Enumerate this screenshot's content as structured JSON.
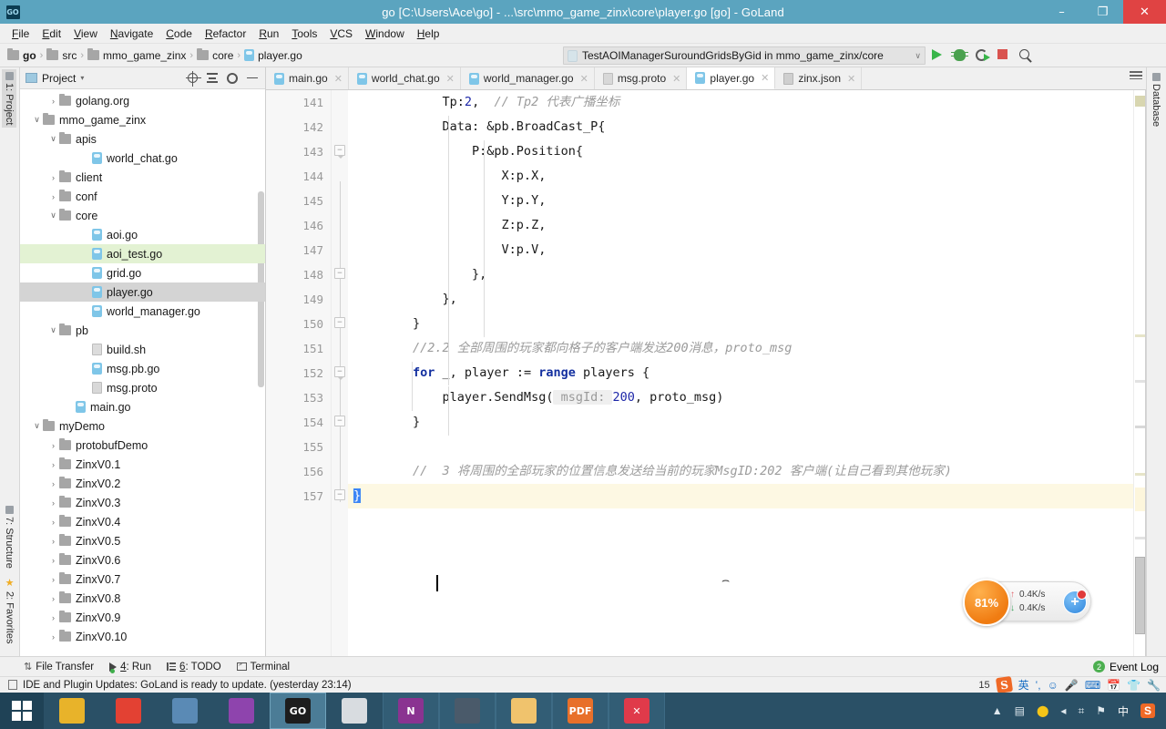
{
  "window": {
    "title": "go [C:\\Users\\Ace\\go] - ...\\src\\mmo_game_zinx\\core\\player.go [go] - GoLand",
    "app_icon": "GO",
    "minimize": "–",
    "maximize": "❐",
    "close": "✕"
  },
  "menubar": {
    "items": [
      "File",
      "Edit",
      "View",
      "Navigate",
      "Code",
      "Refactor",
      "Run",
      "Tools",
      "VCS",
      "Window",
      "Help"
    ]
  },
  "breadcrumb": {
    "items": [
      {
        "label": "go",
        "icon": "folder-icon",
        "bold": true
      },
      {
        "label": "src",
        "icon": "folder-icon",
        "bold": false
      },
      {
        "label": "mmo_game_zinx",
        "icon": "folder-icon",
        "bold": false
      },
      {
        "label": "core",
        "icon": "folder-icon",
        "bold": false
      },
      {
        "label": "player.go",
        "icon": "go-file-icon",
        "bold": false
      }
    ],
    "separator": "›"
  },
  "run_config": {
    "label": "TestAOIManagerSuroundGridsByGid in mmo_game_zinx/core",
    "dropdown_arrow": "∨",
    "buttons": [
      "run-icon",
      "debug-icon",
      "run-coverage-icon",
      "stop-icon",
      "search-everywhere-icon"
    ]
  },
  "project_panel": {
    "title": "Project",
    "caret": "▾",
    "toolbar_icons": [
      "locate-icon",
      "collapse-all-icon",
      "settings-gear-icon",
      "hide-panel-icon"
    ],
    "tree": [
      {
        "depth": 2,
        "arrow": "›",
        "icon": "folder-icon",
        "label": "golang.org",
        "state": "collapsed"
      },
      {
        "depth": 1,
        "arrow": "∨",
        "icon": "folder-icon",
        "label": "mmo_game_zinx",
        "state": "expanded"
      },
      {
        "depth": 2,
        "arrow": "∨",
        "icon": "folder-icon",
        "label": "apis",
        "state": "expanded"
      },
      {
        "depth": 4,
        "arrow": "",
        "icon": "go-file-icon",
        "label": "world_chat.go",
        "state": "file"
      },
      {
        "depth": 2,
        "arrow": "›",
        "icon": "folder-icon",
        "label": "client",
        "state": "collapsed"
      },
      {
        "depth": 2,
        "arrow": "›",
        "icon": "folder-icon",
        "label": "conf",
        "state": "collapsed"
      },
      {
        "depth": 2,
        "arrow": "∨",
        "icon": "folder-icon",
        "label": "core",
        "state": "expanded"
      },
      {
        "depth": 4,
        "arrow": "",
        "icon": "go-file-icon",
        "label": "aoi.go",
        "state": "file"
      },
      {
        "depth": 4,
        "arrow": "",
        "icon": "go-test-file-icon",
        "label": "aoi_test.go",
        "state": "file",
        "highlight": "green"
      },
      {
        "depth": 4,
        "arrow": "",
        "icon": "go-file-icon",
        "label": "grid.go",
        "state": "file"
      },
      {
        "depth": 4,
        "arrow": "",
        "icon": "go-file-icon",
        "label": "player.go",
        "state": "file",
        "highlight": "selected"
      },
      {
        "depth": 4,
        "arrow": "",
        "icon": "go-file-icon",
        "label": "world_manager.go",
        "state": "file"
      },
      {
        "depth": 2,
        "arrow": "∨",
        "icon": "folder-icon",
        "label": "pb",
        "state": "expanded"
      },
      {
        "depth": 4,
        "arrow": "",
        "icon": "sh-file-icon",
        "label": "build.sh",
        "state": "file"
      },
      {
        "depth": 4,
        "arrow": "",
        "icon": "go-file-icon",
        "label": "msg.pb.go",
        "state": "file"
      },
      {
        "depth": 4,
        "arrow": "",
        "icon": "proto-file-icon",
        "label": "msg.proto",
        "state": "file"
      },
      {
        "depth": 3,
        "arrow": "",
        "icon": "go-file-icon",
        "label": "main.go",
        "state": "file"
      },
      {
        "depth": 1,
        "arrow": "∨",
        "icon": "folder-icon",
        "label": "myDemo",
        "state": "expanded"
      },
      {
        "depth": 2,
        "arrow": "›",
        "icon": "folder-icon",
        "label": "protobufDemo",
        "state": "collapsed"
      },
      {
        "depth": 2,
        "arrow": "›",
        "icon": "folder-icon",
        "label": "ZinxV0.1",
        "state": "collapsed"
      },
      {
        "depth": 2,
        "arrow": "›",
        "icon": "folder-icon",
        "label": "ZinxV0.2",
        "state": "collapsed"
      },
      {
        "depth": 2,
        "arrow": "›",
        "icon": "folder-icon",
        "label": "ZinxV0.3",
        "state": "collapsed"
      },
      {
        "depth": 2,
        "arrow": "›",
        "icon": "folder-icon",
        "label": "ZinxV0.4",
        "state": "collapsed"
      },
      {
        "depth": 2,
        "arrow": "›",
        "icon": "folder-icon",
        "label": "ZinxV0.5",
        "state": "collapsed"
      },
      {
        "depth": 2,
        "arrow": "›",
        "icon": "folder-icon",
        "label": "ZinxV0.6",
        "state": "collapsed"
      },
      {
        "depth": 2,
        "arrow": "›",
        "icon": "folder-icon",
        "label": "ZinxV0.7",
        "state": "collapsed"
      },
      {
        "depth": 2,
        "arrow": "›",
        "icon": "folder-icon",
        "label": "ZinxV0.8",
        "state": "collapsed"
      },
      {
        "depth": 2,
        "arrow": "›",
        "icon": "folder-icon",
        "label": "ZinxV0.9",
        "state": "collapsed"
      },
      {
        "depth": 2,
        "arrow": "›",
        "icon": "folder-icon",
        "label": "ZinxV0.10",
        "state": "collapsed"
      }
    ]
  },
  "left_tool_strips": {
    "project": "1: Project",
    "structure": "7: Structure",
    "favorites": "2: Favorites"
  },
  "right_tool_strips": {
    "database": "Database"
  },
  "editor_tabs": [
    {
      "label": "main.go",
      "icon": "go-file-icon",
      "active": false,
      "close": "✕"
    },
    {
      "label": "world_chat.go",
      "icon": "go-file-icon",
      "active": false,
      "close": "✕"
    },
    {
      "label": "world_manager.go",
      "icon": "go-file-icon",
      "active": false,
      "close": "✕"
    },
    {
      "label": "msg.proto",
      "icon": "proto-file-icon",
      "active": false,
      "close": "✕"
    },
    {
      "label": "player.go",
      "icon": "go-file-icon",
      "active": true,
      "close": "✕"
    },
    {
      "label": "zinx.json",
      "icon": "json-file-icon",
      "active": false,
      "close": "✕"
    }
  ],
  "editor": {
    "first_line": 141,
    "lines": [
      {
        "n": 141,
        "indent": 12,
        "segments": [
          {
            "t": "Tp:",
            "c": "plain"
          },
          {
            "t": "2",
            "c": "num"
          },
          {
            "t": ",  ",
            "c": "plain"
          },
          {
            "t": "// Tp2 代表广播坐标",
            "c": "cm"
          }
        ]
      },
      {
        "n": 142,
        "indent": 12,
        "segments": [
          {
            "t": "Data: &pb.BroadCast_P{",
            "c": "plain"
          }
        ]
      },
      {
        "n": 143,
        "indent": 16,
        "segments": [
          {
            "t": "P:&pb.Position{",
            "c": "plain"
          }
        ]
      },
      {
        "n": 144,
        "indent": 20,
        "segments": [
          {
            "t": "X:p.X,",
            "c": "plain"
          }
        ]
      },
      {
        "n": 145,
        "indent": 20,
        "segments": [
          {
            "t": "Y:p.Y,",
            "c": "plain"
          }
        ]
      },
      {
        "n": 146,
        "indent": 20,
        "segments": [
          {
            "t": "Z:p.Z,",
            "c": "plain"
          }
        ]
      },
      {
        "n": 147,
        "indent": 20,
        "segments": [
          {
            "t": "V:p.V,",
            "c": "plain"
          }
        ]
      },
      {
        "n": 148,
        "indent": 16,
        "segments": [
          {
            "t": "},",
            "c": "plain"
          }
        ]
      },
      {
        "n": 149,
        "indent": 12,
        "segments": [
          {
            "t": "},",
            "c": "plain"
          }
        ]
      },
      {
        "n": 150,
        "indent": 8,
        "segments": [
          {
            "t": "}",
            "c": "plain"
          }
        ]
      },
      {
        "n": 151,
        "indent": 8,
        "segments": [
          {
            "t": "//2.2 全部周围的玩家都向格子的客户端发送200消息，proto_msg",
            "c": "cm"
          }
        ]
      },
      {
        "n": 152,
        "indent": 8,
        "segments": [
          {
            "t": "for",
            "c": "k"
          },
          {
            "t": " _, player := ",
            "c": "plain"
          },
          {
            "t": "range",
            "c": "k"
          },
          {
            "t": " players {",
            "c": "plain"
          }
        ]
      },
      {
        "n": 153,
        "indent": 12,
        "segments": [
          {
            "t": "player.SendMsg(",
            "c": "plain"
          },
          {
            "t": " msgId: ",
            "c": "hint"
          },
          {
            "t": "200",
            "c": "num"
          },
          {
            "t": ", proto_msg)",
            "c": "plain"
          }
        ]
      },
      {
        "n": 154,
        "indent": 8,
        "segments": [
          {
            "t": "}",
            "c": "plain"
          }
        ]
      },
      {
        "n": 155,
        "indent": 0,
        "segments": []
      },
      {
        "n": 156,
        "indent": 8,
        "segments": [
          {
            "t": "//  3 将周围的全部玩家的位置信息发送给当前的玩家MsgID:202 客户端(让自己看到其他玩家)",
            "c": "cm"
          }
        ]
      },
      {
        "n": 157,
        "indent": 0,
        "highlight": true,
        "segments": [
          {
            "t": "}",
            "c": "sel"
          }
        ]
      }
    ]
  },
  "network_widget": {
    "percent": "81%",
    "upload": "0.4K/s",
    "download": "0.4K/s",
    "up_arrow": "↑",
    "down_arrow": "↓",
    "plus": "+"
  },
  "toolwindow_bar": {
    "items": [
      {
        "label": "File Transfer",
        "prefix": "",
        "icon": "file-transfer-icon"
      },
      {
        "label": ": Run",
        "prefix": "4",
        "icon": "run-icon"
      },
      {
        "label": ": TODO",
        "prefix": "6",
        "icon": "todo-icon"
      },
      {
        "label": "Terminal",
        "prefix": "",
        "icon": "terminal-icon"
      }
    ],
    "event_log": "Event Log",
    "event_log_count": "2"
  },
  "notification_bar": {
    "text": "IDE and Plugin Updates: GoLand is ready to update. (yesterday 23:14)",
    "ime_number": "15",
    "sogou": "S",
    "tray_icons": [
      "chinese-english-icon",
      "voice-input-icon",
      "smiley-icon",
      "mic-icon",
      "keyboard-icon",
      "calendar-icon",
      "skin-icon",
      "tools-icon"
    ],
    "ime_lang": "英"
  },
  "taskbar": {
    "start_icon": "windows-logo-icon",
    "apps": [
      {
        "name": "media-player-icon",
        "label": "",
        "color": "#e8b32a",
        "active": false
      },
      {
        "name": "chrome-icon",
        "label": "",
        "color": "#e34133",
        "active": false
      },
      {
        "name": "remote-desktop-icon",
        "label": "",
        "color": "#5a8ab5",
        "active": false
      },
      {
        "name": "visual-studio-icon",
        "label": "",
        "color": "#8e44ad",
        "active": false
      },
      {
        "name": "goland-icon",
        "label": "GO",
        "color": "#1d1d1d",
        "active": true
      },
      {
        "name": "paint-icon",
        "label": "",
        "color": "#d8dce0",
        "active": false
      },
      {
        "name": "onenote-icon",
        "label": "N",
        "color": "#8a3391",
        "active": false,
        "grouped": true
      },
      {
        "name": "virtualbox-icon",
        "label": "",
        "color": "#4a5a6a",
        "active": false,
        "grouped": true
      },
      {
        "name": "explorer-icon",
        "label": "",
        "color": "#f0c36d",
        "active": false,
        "grouped": true
      },
      {
        "name": "pdf-reader-icon",
        "label": "PDF",
        "color": "#e8702a",
        "active": false,
        "grouped": true
      },
      {
        "name": "xmind-icon",
        "label": "✕",
        "color": "#e03a4a",
        "active": false,
        "grouped": true
      }
    ],
    "tray": [
      {
        "name": "show-hidden-icons",
        "glyph": "▲"
      },
      {
        "name": "video-recorder-icon",
        "glyph": "▤"
      },
      {
        "name": "update-icon",
        "glyph": "⬤"
      },
      {
        "name": "volume-icon",
        "glyph": "◂"
      },
      {
        "name": "network-icon",
        "glyph": "⌗"
      },
      {
        "name": "flag-icon",
        "glyph": "⚑"
      },
      {
        "name": "ime-chinese-icon",
        "glyph": "中"
      },
      {
        "name": "sogou-icon",
        "glyph": "S"
      }
    ]
  }
}
